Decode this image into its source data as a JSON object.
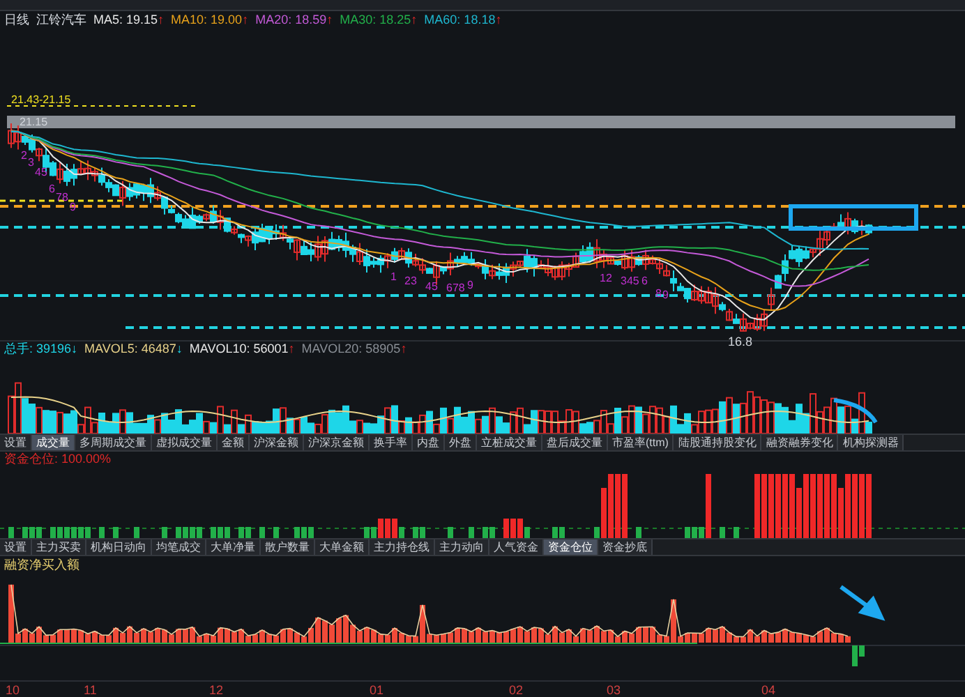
{
  "legend": {
    "period": "日线",
    "stock": "江铃汽车",
    "ma": [
      {
        "label": "MA5: 19.15",
        "arrow": "↑",
        "color": "#e8e8e8"
      },
      {
        "label": "MA10: 19.00",
        "arrow": "↑",
        "color": "#e8a21a"
      },
      {
        "label": "MA20: 18.59",
        "arrow": "↑",
        "color": "#c45ad8"
      },
      {
        "label": "MA30: 18.25",
        "arrow": "↑",
        "color": "#22b04a"
      },
      {
        "label": "MA60: 18.18",
        "arrow": "↑",
        "color": "#1eb7d0"
      }
    ]
  },
  "main_chart": {
    "range_label": "21.43-21.15",
    "high_label": "21.15",
    "low_label": "16.8",
    "td_marks": [
      "2",
      "3",
      "45",
      "6",
      "78",
      "9",
      "1",
      "23",
      "45",
      "678",
      "9",
      "12",
      "345",
      "6",
      "8",
      "9"
    ]
  },
  "volume": {
    "stats": [
      {
        "label": "总手: 39196",
        "arrow": "↓",
        "color": "#1ed6e8"
      },
      {
        "label": "MAVOL5: 46487",
        "arrow": "↓",
        "color": "#e8d28a"
      },
      {
        "label": "MAVOL10: 56001",
        "arrow": "↑",
        "color": "#e8e8e8"
      },
      {
        "label": "MAVOL20: 58905",
        "arrow": "↑",
        "color": "#8a8f96"
      }
    ]
  },
  "indicator_tabs": [
    {
      "label": "设置",
      "selected": false
    },
    {
      "label": "成交量",
      "selected": true
    },
    {
      "label": "多周期成交量",
      "selected": false
    },
    {
      "label": "虚拟成交量",
      "selected": false
    },
    {
      "label": "金额",
      "selected": false
    },
    {
      "label": "沪深金额",
      "selected": false
    },
    {
      "label": "沪深京金额",
      "selected": false
    },
    {
      "label": "换手率",
      "selected": false
    },
    {
      "label": "内盘",
      "selected": false
    },
    {
      "label": "外盘",
      "selected": false
    },
    {
      "label": "立桩成交量",
      "selected": false
    },
    {
      "label": "盘后成交量",
      "selected": false
    },
    {
      "label": "市盈率(ttm)",
      "selected": false
    },
    {
      "label": "陆股通持股变化",
      "selected": false
    },
    {
      "label": "融资融券变化",
      "selected": false
    },
    {
      "label": "机构探测器",
      "selected": false
    }
  ],
  "position": {
    "label": "资金仓位: 100.00%"
  },
  "fund_tabs": [
    {
      "label": "设置",
      "selected": false
    },
    {
      "label": "主力买卖",
      "selected": false
    },
    {
      "label": "机构日动向",
      "selected": false
    },
    {
      "label": "均笔成交",
      "selected": false
    },
    {
      "label": "大单净量",
      "selected": false
    },
    {
      "label": "散户数量",
      "selected": false
    },
    {
      "label": "大单金额",
      "selected": false
    },
    {
      "label": "主力持仓线",
      "selected": false
    },
    {
      "label": "主力动向",
      "selected": false
    },
    {
      "label": "人气资金",
      "selected": false
    },
    {
      "label": "资金仓位",
      "selected": true
    },
    {
      "label": "资金抄底",
      "selected": false
    }
  ],
  "margin": {
    "label": "融资净买入额"
  },
  "months": [
    "10",
    "11",
    "12",
    "01",
    "02",
    "03",
    "04"
  ]
}
